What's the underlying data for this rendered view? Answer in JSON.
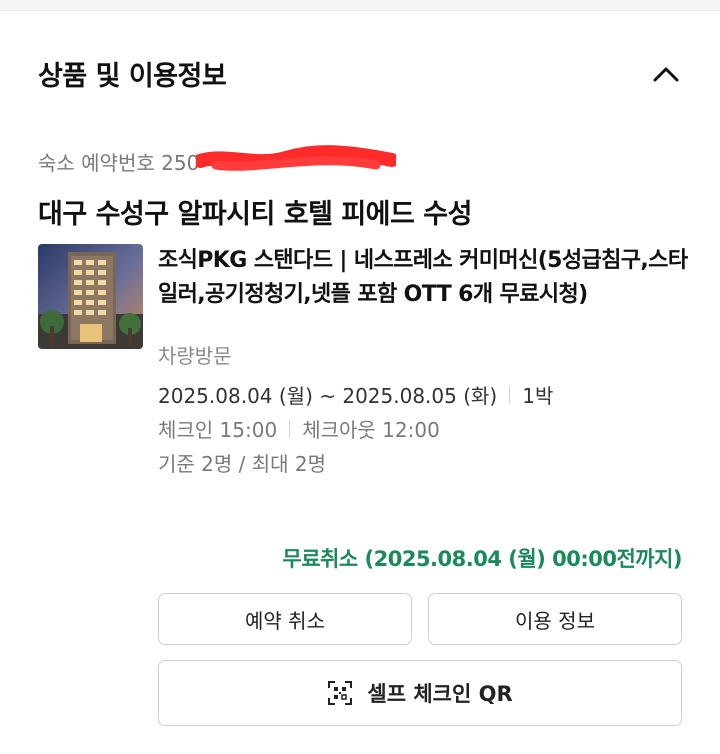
{
  "section": {
    "title": "상품 및 이용정보",
    "collapse_icon": "chevron-up-icon"
  },
  "reservation": {
    "label_prefix": "숙소 예약번호 250"
  },
  "hotel": {
    "name": "대구 수성구 알파시티 호텔 피에드 수성"
  },
  "room": {
    "name": "조식PKG 스탠다드 | 네스프레소 커미머신(5성급침구,스타일러,공기정청기,넷플 포함 OTT 6개 무료시청)",
    "visit_type": "차량방문"
  },
  "stay": {
    "date_range": "2025.08.04 (월) ~ 2025.08.05 (화)",
    "nights": "1박",
    "checkin": "체크인 15:00",
    "checkout": "체크아웃 12:00",
    "guests": "기준 2명 / 최대 2명"
  },
  "cancellation": {
    "free_cancel_text": "무료취소 (2025.08.04 (월) 00:00전까지)",
    "color": "#1b8a5a"
  },
  "actions": {
    "cancel_label": "예약 취소",
    "info_label": "이용 정보",
    "qr_label": "셀프 체크인 QR",
    "qr_icon": "qr-code-icon"
  }
}
